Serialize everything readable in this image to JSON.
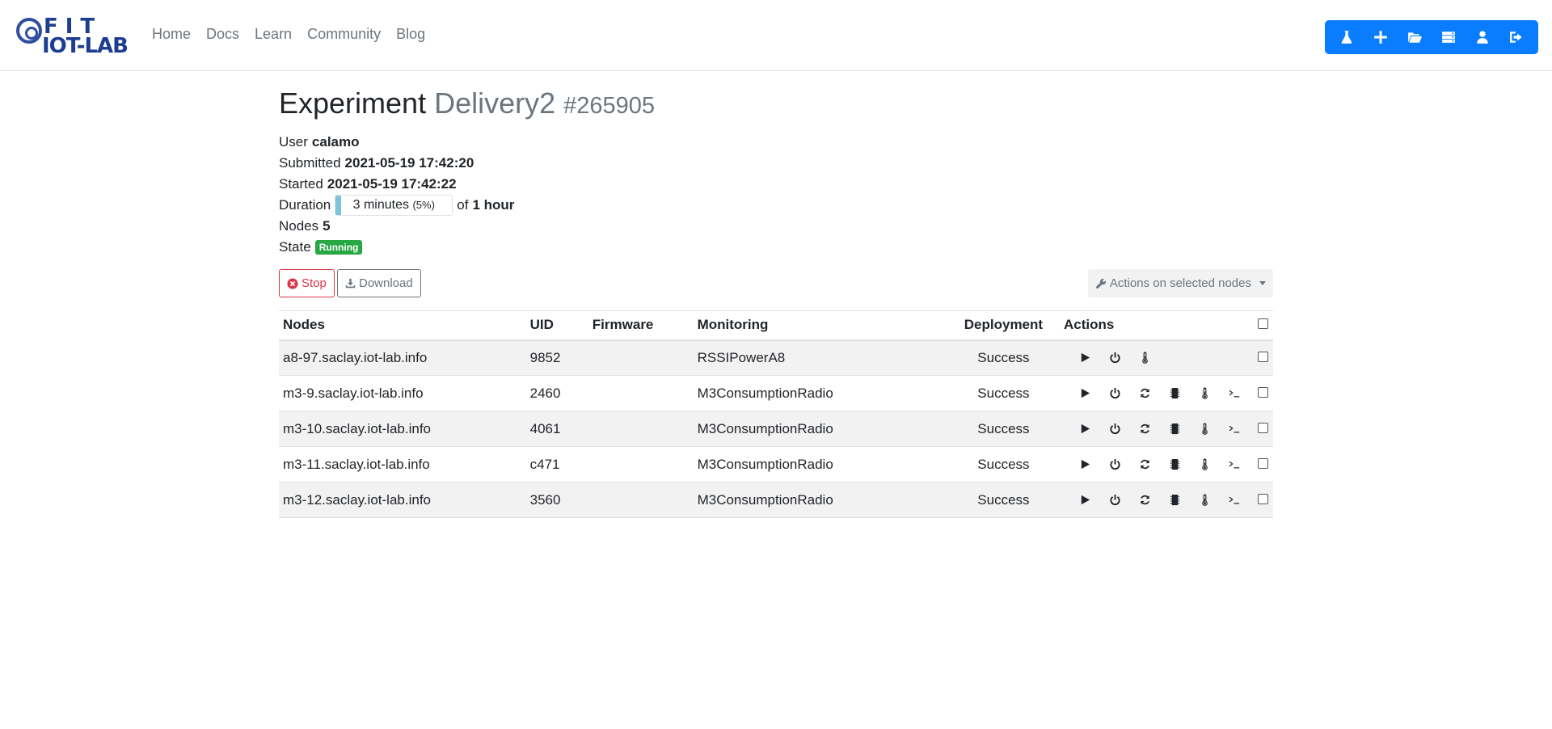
{
  "brand": {
    "line1": "FIT",
    "line2": "IOT-LAB"
  },
  "nav": [
    {
      "label": "Home"
    },
    {
      "label": "Docs"
    },
    {
      "label": "Learn"
    },
    {
      "label": "Community"
    },
    {
      "label": "Blog"
    }
  ],
  "toolbar": [
    {
      "icon": "flask-icon"
    },
    {
      "icon": "plus-icon"
    },
    {
      "icon": "folder-open-icon"
    },
    {
      "icon": "server-icon"
    },
    {
      "icon": "user-icon"
    },
    {
      "icon": "logout-icon"
    }
  ],
  "experiment": {
    "heading": "Experiment",
    "name": "Delivery2",
    "id": "#265905",
    "user_label": "User",
    "user": "calamo",
    "submitted_label": "Submitted",
    "submitted": "2021-05-19 17:42:20",
    "started_label": "Started",
    "started": "2021-05-19 17:42:22",
    "duration_label": "Duration",
    "duration_elapsed": "3 minutes",
    "duration_percent_text": "(5%)",
    "duration_progress": 0.05,
    "duration_of": "of",
    "duration_total": "1 hour",
    "nodes_label": "Nodes",
    "nodes": "5",
    "state_label": "State",
    "state": "Running",
    "state_color": "#28a745"
  },
  "buttons": {
    "stop": "Stop",
    "download": "Download",
    "selected_actions": "Actions on selected nodes"
  },
  "table": {
    "headers": {
      "nodes": "Nodes",
      "uid": "UID",
      "firmware": "Firmware",
      "monitoring": "Monitoring",
      "deployment": "Deployment",
      "actions": "Actions"
    },
    "rows": [
      {
        "node": "a8-97.saclay.iot-lab.info",
        "uid": "9852",
        "firmware": "",
        "monitoring": "RSSIPowerA8",
        "deployment": "Success"
      },
      {
        "node": "m3-9.saclay.iot-lab.info",
        "uid": "2460",
        "firmware": "",
        "monitoring": "M3ConsumptionRadio",
        "deployment": "Success"
      },
      {
        "node": "m3-10.saclay.iot-lab.info",
        "uid": "4061",
        "firmware": "",
        "monitoring": "M3ConsumptionRadio",
        "deployment": "Success"
      },
      {
        "node": "m3-11.saclay.iot-lab.info",
        "uid": "c471",
        "firmware": "",
        "monitoring": "M3ConsumptionRadio",
        "deployment": "Success"
      },
      {
        "node": "m3-12.saclay.iot-lab.info",
        "uid": "3560",
        "firmware": "",
        "monitoring": "M3ConsumptionRadio",
        "deployment": "Success"
      }
    ]
  },
  "colors": {
    "primary": "#0a7cff",
    "danger": "#dc3545",
    "success": "#28a745",
    "muted": "#6c757d"
  }
}
